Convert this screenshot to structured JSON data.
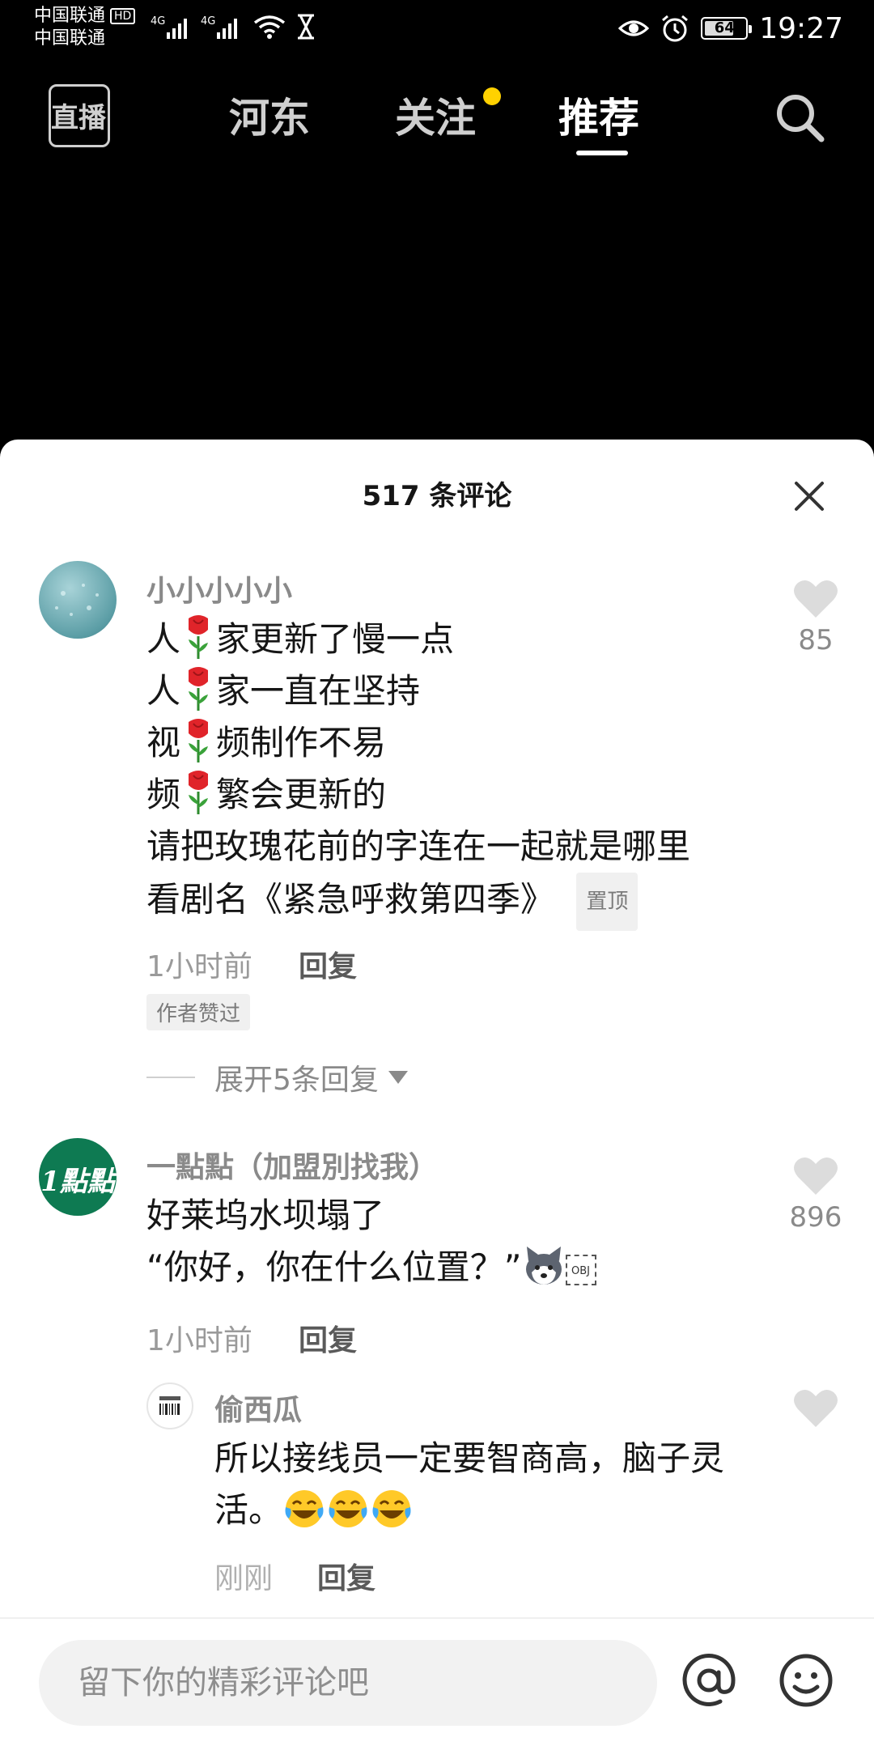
{
  "status_bar": {
    "carrier1": "中国联通",
    "hd": "HD",
    "carrier2": "中国联通",
    "network1": "4G",
    "network2": "4G",
    "battery": "64",
    "time": "19:27"
  },
  "top_nav": {
    "live_label": "直播",
    "tabs": [
      {
        "label": "河东",
        "active": false
      },
      {
        "label": "关注",
        "active": false,
        "has_dot": true
      },
      {
        "label": "推荐",
        "active": true
      }
    ]
  },
  "comments_sheet": {
    "title": "517 条评论",
    "comments": [
      {
        "username": "小小小小小",
        "lines": [
          {
            "before": "人",
            "after": "家更新了慢一点"
          },
          {
            "before": "人",
            "after": "家一直在坚持"
          },
          {
            "before": "视",
            "after": "频制作不易"
          },
          {
            "before": "频",
            "after": "繁会更新的"
          }
        ],
        "line5": "请把玫瑰花前的字连在一起就是哪里",
        "line6": "看剧名《紧急呼救第四季》",
        "pinned_badge": "置顶",
        "time": "1小时前",
        "reply": "回复",
        "author_liked": "作者赞过",
        "likes": "85",
        "expand": "展开5条回复"
      },
      {
        "username": "一點點（加盟別找我）",
        "line1": "好莱坞水坝塌了",
        "line2": "“你好，你在什么位置？”",
        "obj": "OBJ",
        "time": "1小时前",
        "reply": "回复",
        "likes": "896",
        "avatar_text": "1點點"
      },
      {
        "username": "偷西瓜",
        "line1": "所以接线员一定要智商高，脑子灵",
        "line2": "活。",
        "time": "刚刚",
        "reply": "回复"
      }
    ]
  },
  "input_bar": {
    "placeholder": "留下你的精彩评论吧"
  },
  "colors": {
    "accent_dot": "#ffd100",
    "background_top": "#000000",
    "sheet_bg": "#ffffff"
  }
}
